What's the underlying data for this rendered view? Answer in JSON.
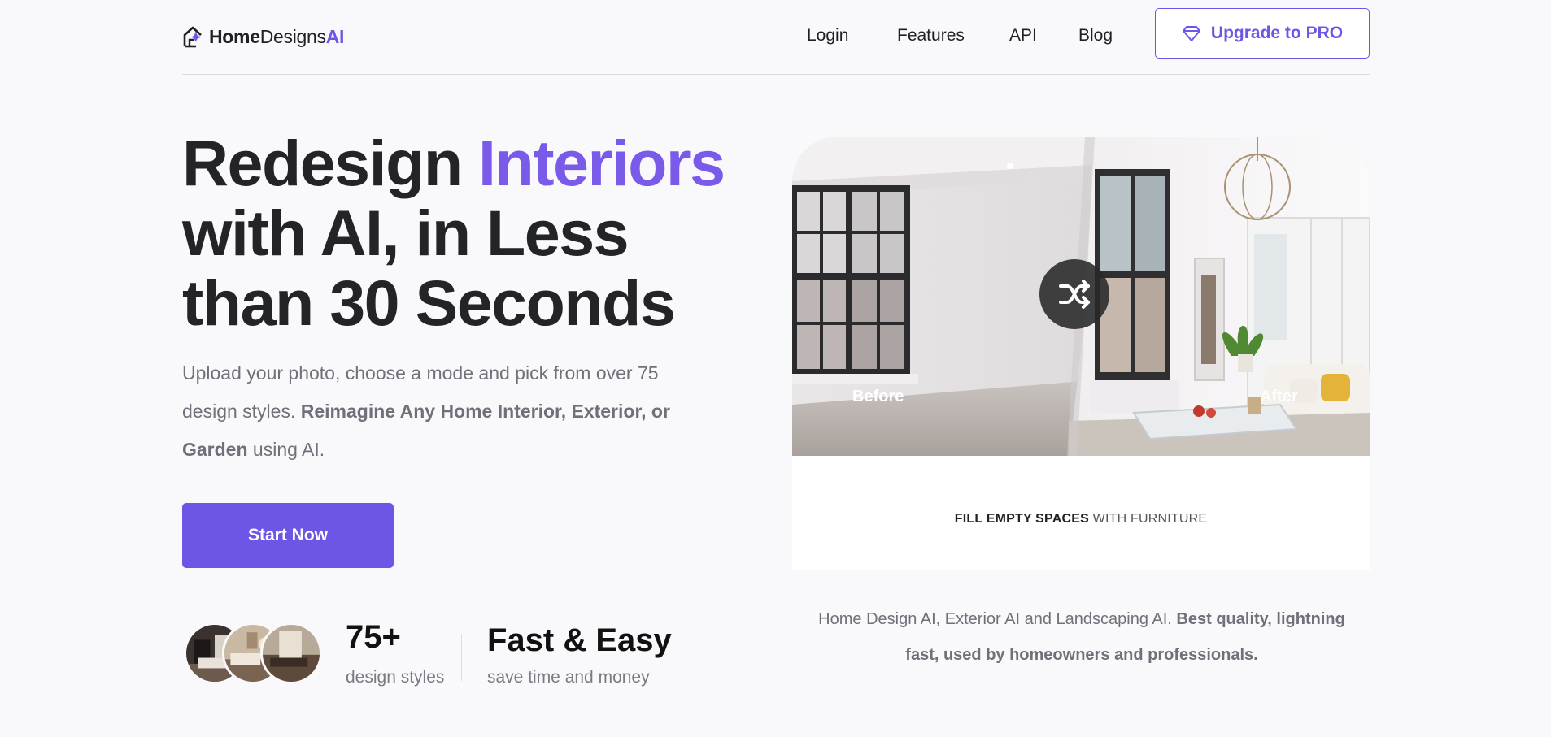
{
  "brand": {
    "part1": "Home",
    "part2": "Designs",
    "part3": "AI",
    "accent_color": "#6d55e6"
  },
  "nav": {
    "login": "Login",
    "features": "Features",
    "api": "API",
    "blog": "Blog",
    "upgrade": "Upgrade to PRO",
    "upgrade_icon": "diamond-icon"
  },
  "hero": {
    "title_part1": "Redesign ",
    "title_accent": "Interiors",
    "title_part2": "with AI, in Less than 30 Seconds",
    "sub_part1": "Upload your photo, choose a mode and pick from over 75 design styles. ",
    "sub_bold": "Reimagine Any Home Interior, Exterior, or Garden",
    "sub_part2": " using AI.",
    "cta": "Start Now"
  },
  "stats": {
    "styles_num": "75+",
    "styles_label": "design styles",
    "speed_title": "Fast & Easy",
    "speed_label": "save time and money"
  },
  "showcase": {
    "before_label": "Before",
    "after_label": "After",
    "shuffle_icon": "shuffle-icon",
    "caption_bold": "FILL EMPTY SPACES",
    "caption_rest": " WITH FURNITURE"
  },
  "tagline": {
    "part1": "Home Design AI, Exterior AI and Landscaping AI. ",
    "bold": "Best quality, lightning fast, used by homeowners and professionals."
  }
}
